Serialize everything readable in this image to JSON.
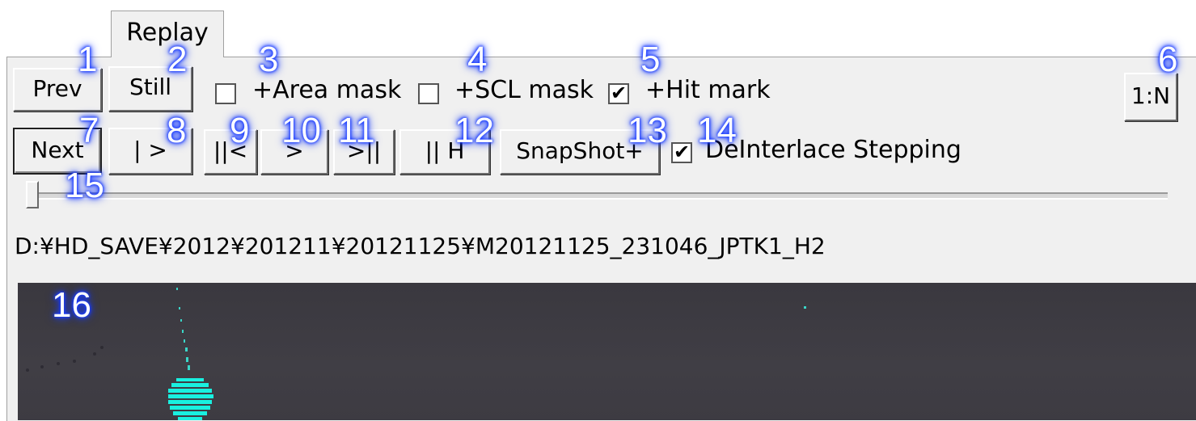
{
  "tab": {
    "label": "Replay"
  },
  "row1": {
    "prev": "Prev",
    "still": "Still",
    "area_mask": {
      "label": "+Area mask",
      "checked": false
    },
    "scl_mask": {
      "label": "+SCL mask",
      "checked": false
    },
    "hit_mark": {
      "label": "+Hit mark",
      "checked": true
    },
    "ratio": "1:N"
  },
  "row2": {
    "next": "Next",
    "play": "| >",
    "step_back": "||<",
    "forward": ">",
    "step_fwd": ">||",
    "pause_h": "|| H",
    "snapshot": "SnapShot+",
    "deinterlace": {
      "label": "DeInterlace Stepping",
      "checked": true
    }
  },
  "slider": {
    "position": 0
  },
  "file_path": "D:¥HD_SAVE¥2012¥201211¥20121125¥M20121125_231046_JPTK1_H2",
  "markers": [
    "1",
    "2",
    "3",
    "4",
    "5",
    "6",
    "7",
    "8",
    "9",
    "10",
    "11",
    "12",
    "13",
    "14",
    "15",
    "16"
  ]
}
